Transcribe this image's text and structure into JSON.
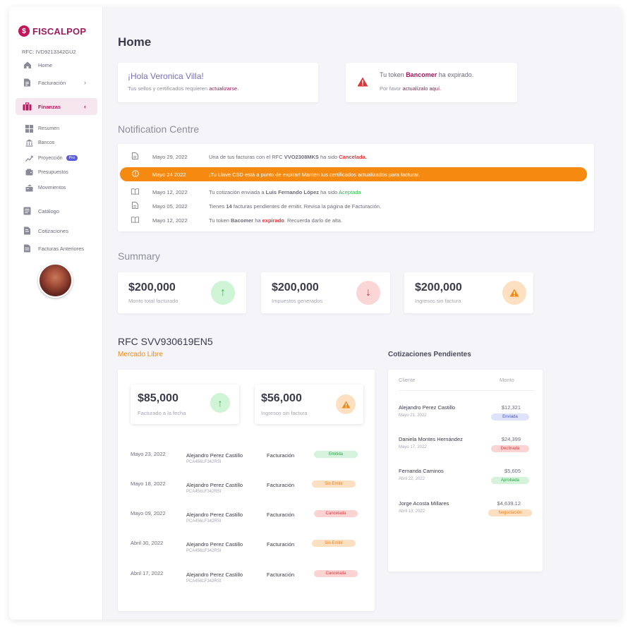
{
  "brand": {
    "name": "FISCALPOP",
    "accent": "#9c1b5e",
    "orange": "#f6890f"
  },
  "sidebar": {
    "rfc": "RFC: IVD9213342GU2",
    "items": [
      {
        "label": "Home",
        "icon": "home-icon"
      },
      {
        "label": "Facturación",
        "icon": "document-icon"
      },
      {
        "label": "Finanzas",
        "icon": "briefcase-icon"
      },
      {
        "label": "Catálogo",
        "icon": "catalog-icon"
      },
      {
        "label": "Cotizaciones",
        "icon": "quote-icon"
      },
      {
        "label": "Facturas Anteriores",
        "icon": "archive-icon"
      }
    ],
    "subitems": [
      {
        "label": "Resumen",
        "icon": "grid-icon"
      },
      {
        "label": "Bancos",
        "icon": "bank-icon"
      },
      {
        "label": "Proyección",
        "icon": "chart-icon",
        "badge": "Pro"
      },
      {
        "label": "Presupuestos",
        "icon": "wallet-icon"
      },
      {
        "label": "Movimientos",
        "icon": "transfer-icon"
      }
    ]
  },
  "header": {
    "title": "Home"
  },
  "greeting": {
    "title": "¡Hola Veronica Villa!",
    "text_before": "Tus sellos y certificados requieren ",
    "link": "actualizarse."
  },
  "token_alert": {
    "text_before": "Tu token ",
    "bank": "Bancomer",
    "text_after": " ha expirado.",
    "line2_before": "Por favor ",
    "line2_link": "actualízalo aquí."
  },
  "notifications": {
    "title": "Notification Centre",
    "items": [
      {
        "icon": "document-icon",
        "date": "Mayo 29, 2022",
        "parts": [
          "Una de tus facturas con el RFC ",
          "VVO2308MKS",
          " ha sido ",
          "Cancelada."
        ]
      },
      {
        "icon": "alert-circle-icon",
        "date": "Mayo 24 2022",
        "parts": [
          "¡Tu Llave CSD está a punto de expirar! Manten tus certificados actualizados para facturar."
        ]
      },
      {
        "icon": "book-icon",
        "date": "Mayo 12, 2022",
        "parts": [
          "Tu cotización enviada a ",
          "Luis Fernando López",
          " ha sido ",
          "Aceptada"
        ]
      },
      {
        "icon": "document-icon",
        "date": "Mayo 05, 2022",
        "parts": [
          "Tienes ",
          "14",
          " facturas pendientes de emitir. Revisa la página de Facturación."
        ]
      },
      {
        "icon": "book-icon",
        "date": "Mayo 12, 2022",
        "parts": [
          "Tu token ",
          "Bacomer",
          " ha ",
          "expirado",
          ". Recuerda darlo de alta."
        ]
      }
    ]
  },
  "summary": {
    "title": "Summary",
    "cards": [
      {
        "value": "$200,000",
        "label": "Monto total facturado",
        "icon": "arrow-up-icon"
      },
      {
        "value": "$200,000",
        "label": "Impuestos generados",
        "icon": "arrow-down-icon"
      },
      {
        "value": "$200,000",
        "label": "Ingresos sin factura",
        "icon": "warning-icon"
      }
    ]
  },
  "rfc_section": {
    "title": "RFC SVV930619EN5",
    "subtitle": "Mercado Libre",
    "cards": [
      {
        "value": "$85,000",
        "label": "Facturado a la fecha",
        "icon": "arrow-up-icon"
      },
      {
        "value": "$56,000",
        "label": "Ingresos sin factura",
        "icon": "warning-icon"
      }
    ],
    "transactions": [
      {
        "date": "Mayo 23, 2022",
        "name": "Alejandro Perez Castillo",
        "code": "PCA456LF342RSI",
        "type": "Facturación",
        "status": "Emitida"
      },
      {
        "date": "Mayo 18, 2022",
        "name": "Alejandro Perez Castillo",
        "code": "PCA456LF342RSI",
        "type": "Facturación",
        "status": "Sin Emitir"
      },
      {
        "date": "Mayo 09, 2022",
        "name": "Alejandro Perez Castillo",
        "code": "PCA456LF342RSI",
        "type": "Facturación",
        "status": "Cancelada"
      },
      {
        "date": "Abril 30, 2022",
        "name": "Alejandro Perez Castillo",
        "code": "PCA456LF342RSI",
        "type": "Facturación",
        "status": "Sin Emitir"
      },
      {
        "date": "Abril 17, 2022",
        "name": "Alejandro Perez Castillo",
        "code": "PCA456LF342RSI",
        "type": "Facturación",
        "status": "Cancelada"
      }
    ]
  },
  "cotizaciones": {
    "title": "Cotizaciones Pendientes",
    "col_cliente": "Cliente",
    "col_monto": "Monto",
    "rows": [
      {
        "client": "Alejandro Perez Castillo",
        "date": "Mayo 21, 2022",
        "amount": "$12,321",
        "status": "Enviada"
      },
      {
        "client": "Daniela Montes Hernández",
        "date": "Mayo 17, 2022",
        "amount": "$24,399",
        "status": "Declinada"
      },
      {
        "client": "Fernanda Caminos",
        "date": "Abril 22, 2022",
        "amount": "$5,605",
        "status": "Aprobada"
      },
      {
        "client": "Jorge Acosta Millares",
        "date": "Abril 13, 2022",
        "amount": "$4,639.12",
        "status": "Negociación"
      }
    ]
  }
}
